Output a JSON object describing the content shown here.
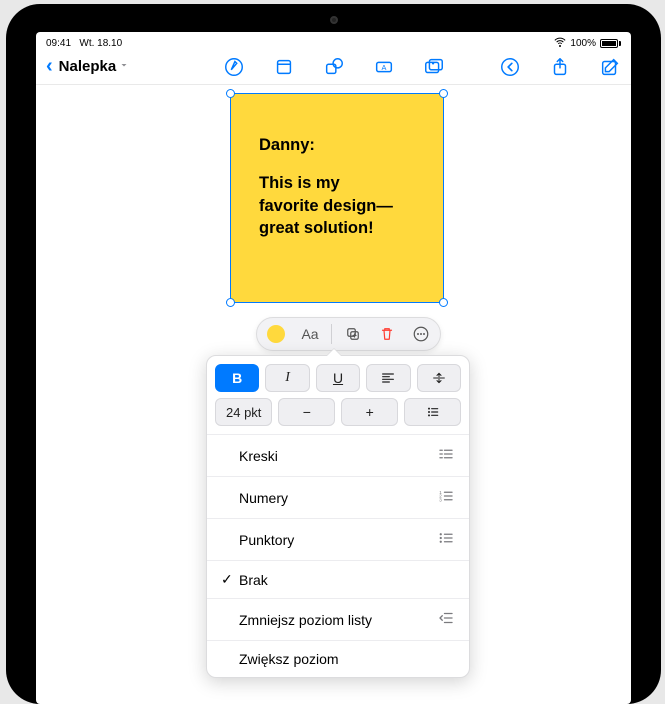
{
  "status": {
    "time": "09:41",
    "date": "Wt. 18.10",
    "battery_pct": "100%"
  },
  "nav": {
    "title": "Nalepka"
  },
  "sticky": {
    "line1": "Danny:",
    "line2": "This is my",
    "line3": "favorite design—",
    "line4": "great solution!"
  },
  "toolbar": {
    "text_label": "Aa"
  },
  "popover": {
    "bold": "B",
    "italic": "I",
    "underline": "U",
    "font_size": "24 pkt",
    "minus": "−",
    "plus": "+",
    "items": [
      {
        "label": "Kreski"
      },
      {
        "label": "Numery"
      },
      {
        "label": "Punktory"
      },
      {
        "label": "Brak",
        "checked": true
      },
      {
        "label": "Zmniejsz poziom listy"
      },
      {
        "label": "Zwiększ poziom"
      }
    ]
  }
}
